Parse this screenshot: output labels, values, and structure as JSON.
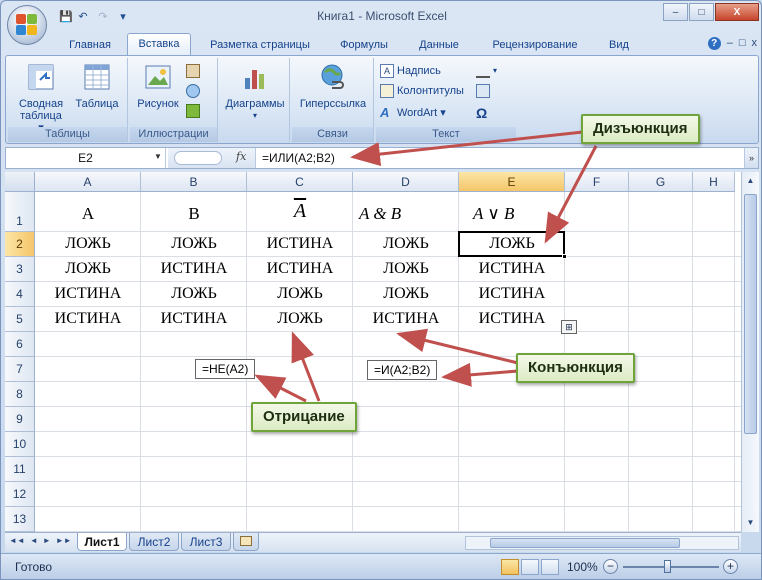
{
  "window": {
    "title": "Книга1 - Microsoft Excel",
    "controls": {
      "minimize": "–",
      "maximize": "□",
      "close": "X"
    }
  },
  "quick_access": {
    "save_icon": "💾",
    "undo_icon": "↶",
    "redo_icon": "↷",
    "customize_icon": "▾"
  },
  "ribbon_tabs": [
    "Главная",
    "Вставка",
    "Разметка страницы",
    "Формулы",
    "Данные",
    "Рецензирование",
    "Вид"
  ],
  "active_tab": "Вставка",
  "ribbon": {
    "groups": {
      "tables": {
        "label": "Таблицы",
        "pivot_line1": "Сводная",
        "pivot_line2": "таблица ▾",
        "table": "Таблица"
      },
      "illustrations": {
        "label": "Иллюстрации",
        "picture": "Рисунок"
      },
      "charts": {
        "diagrams": "Диаграммы",
        "diagrams_arrow": "▾"
      },
      "links": {
        "label": "Связи",
        "hyperlink": "Гиперссылка"
      },
      "text": {
        "label": "Текст",
        "textbox": "Надпись",
        "header_footer": "Колонтитулы",
        "wordart": "WordArt ▾",
        "omega": "Ω"
      }
    }
  },
  "formula_bar": {
    "namebox": "E2",
    "namebox_arrow": "▼",
    "fx": "fx",
    "formula": "=ИЛИ(A2;B2)",
    "expand": "»"
  },
  "grid": {
    "columns": [
      "A",
      "B",
      "C",
      "D",
      "E",
      "F",
      "G",
      "H"
    ],
    "rows": [
      "1",
      "2",
      "3",
      "4",
      "5",
      "6",
      "7",
      "8",
      "9",
      "10",
      "11",
      "12",
      "13"
    ],
    "selected_col": "E",
    "selected_row": "2",
    "header_row": [
      "A",
      "B",
      "A",
      "A & B",
      "A ∨ B"
    ],
    "data": [
      [
        "ЛОЖЬ",
        "ЛОЖЬ",
        "ИСТИНА",
        "ЛОЖЬ",
        "ЛОЖЬ"
      ],
      [
        "ЛОЖЬ",
        "ИСТИНА",
        "ИСТИНА",
        "ЛОЖЬ",
        "ИСТИНА"
      ],
      [
        "ИСТИНА",
        "ЛОЖЬ",
        "ЛОЖЬ",
        "ЛОЖЬ",
        "ИСТИНА"
      ],
      [
        "ИСТИНА",
        "ИСТИНА",
        "ЛОЖЬ",
        "ИСТИНА",
        "ИСТИНА"
      ]
    ],
    "popup_not": "=НЕ(A2)",
    "popup_and": "=И(A2;B2)",
    "paste_icon": "⊞"
  },
  "callouts": {
    "disjunction": "Дизъюнкция",
    "conjunction": "Конъюнкция",
    "negation": "Отрицание"
  },
  "colors": {
    "arrow": "#c0504d",
    "callout_border": "#6fa43a",
    "selection_header": "#f5c56a"
  },
  "sheets": [
    "Лист1",
    "Лист2",
    "Лист3"
  ],
  "active_sheet": "Лист1",
  "sheet_nav": [
    "◄◄",
    "◄",
    "►",
    "►►"
  ],
  "status": {
    "ready": "Готово",
    "zoom": "100%",
    "zoom_minus": "−",
    "zoom_plus": "+"
  },
  "help": {
    "help_icon": "?",
    "min": "–",
    "restore": "□",
    "close": "x"
  }
}
